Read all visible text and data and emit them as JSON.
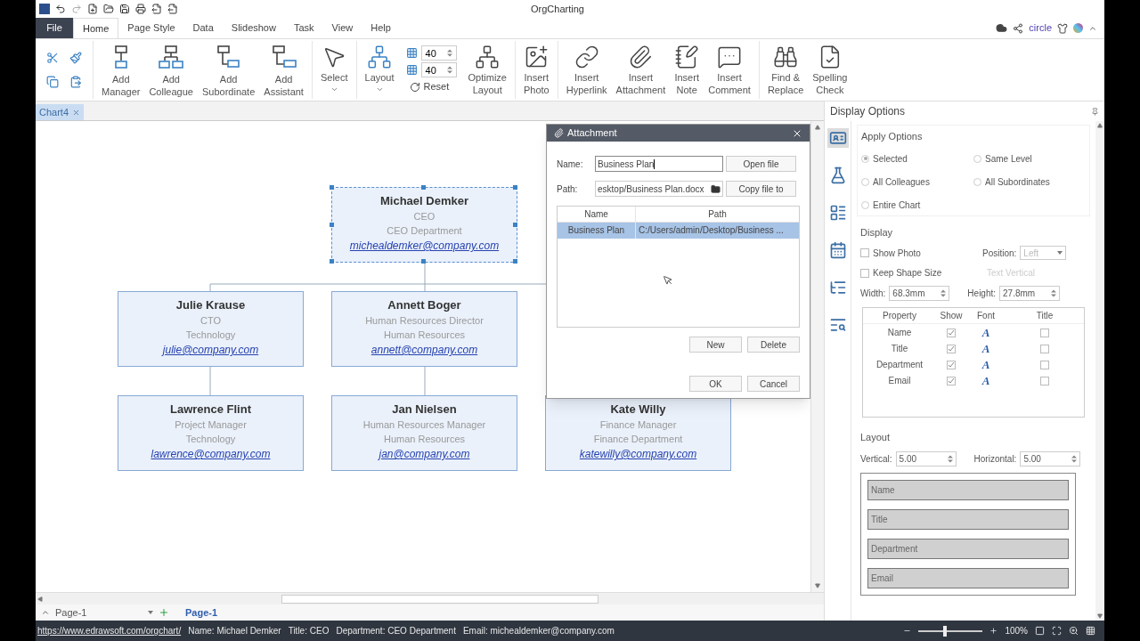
{
  "title_bar": {
    "title": "OrgCharting"
  },
  "menu": {
    "file": "File",
    "tabs": [
      {
        "label": "Home",
        "selected": true
      },
      {
        "label": "Page Style",
        "selected": false
      },
      {
        "label": "Data",
        "selected": false
      },
      {
        "label": "Slideshow",
        "selected": false
      },
      {
        "label": "Task",
        "selected": false
      },
      {
        "label": "View",
        "selected": false
      },
      {
        "label": "Help",
        "selected": false
      }
    ],
    "account": "circle"
  },
  "ribbon": {
    "buttons": [
      {
        "kind": "manager",
        "label": [
          "Add",
          "Manager"
        ]
      },
      {
        "kind": "colleague",
        "label": [
          "Add",
          "Colleague"
        ]
      },
      {
        "kind": "subordinate",
        "label": [
          "Add",
          "Subordinate"
        ]
      },
      {
        "kind": "assistant",
        "label": [
          "Add",
          "Assistant"
        ]
      },
      {
        "kind": "select",
        "label": [
          "Select"
        ],
        "dropdown": true
      },
      {
        "kind": "layout",
        "label": [
          "Layout"
        ],
        "dropdown": true
      },
      {
        "kind": "spacing",
        "values": [
          "40",
          "40"
        ],
        "reset": "Reset"
      },
      {
        "kind": "optimize",
        "label": [
          "Optimize",
          "Layout"
        ]
      },
      {
        "kind": "photo",
        "label": [
          "Insert",
          "Photo"
        ]
      },
      {
        "kind": "hyperlink",
        "label": [
          "Insert",
          "Hyperlink"
        ]
      },
      {
        "kind": "attachment",
        "label": [
          "Insert",
          "Attachment"
        ]
      },
      {
        "kind": "note",
        "label": [
          "Insert",
          "Note"
        ]
      },
      {
        "kind": "comment",
        "label": [
          "Insert",
          "Comment"
        ]
      },
      {
        "kind": "find",
        "label": [
          "Find &",
          "Replace"
        ]
      },
      {
        "kind": "spelling",
        "label": [
          "Spelling",
          "Check"
        ]
      }
    ]
  },
  "document_tabs": [
    {
      "label": "Chart4",
      "selected": true
    }
  ],
  "chart": {
    "nodes": [
      {
        "name": "Michael Demker",
        "title": "CEO",
        "department": "CEO Department",
        "email": "michealdemker@company.com",
        "selected": true
      },
      {
        "name": "Julie Krause",
        "title": "CTO",
        "department": "Technology",
        "email": "julie@company.com",
        "selected": false
      },
      {
        "name": "Annett Boger",
        "title": "Human Resources Director",
        "department": "Human Resources",
        "email": "annett@company.com",
        "selected": false
      },
      {
        "name": "Lawrence Flint",
        "title": "Project Manager",
        "department": "Technology",
        "email": "lawrence@company.com",
        "selected": false
      },
      {
        "name": "Jan Nielsen",
        "title": "Human Resources Manager",
        "department": "Human Resources",
        "email": "jan@company.com",
        "selected": false
      },
      {
        "name": "Kate Willy",
        "title": "Finance Manager",
        "department": "Finance Department",
        "email": "katewilly@company.com",
        "selected": false
      }
    ]
  },
  "dialog": {
    "title": "Attachment",
    "name_label": "Name:",
    "name_value": "Business Plan",
    "open_button": "Open file",
    "path_label": "Path:",
    "path_value": "esktop/Business Plan.docx",
    "copy_button": "Copy file to",
    "columns": [
      "Name",
      "Path"
    ],
    "rows": [
      {
        "name": "Business Plan",
        "path": "C:/Users/admin/Desktop/Business ...",
        "selected": true
      }
    ],
    "buttons": [
      "New",
      "Delete",
      "OK",
      "Cancel"
    ]
  },
  "display_options": {
    "title": "Display Options",
    "side_icons": [
      {
        "kind": "card",
        "selected": true
      },
      {
        "kind": "bottle",
        "selected": false
      },
      {
        "kind": "list",
        "selected": false
      },
      {
        "kind": "calendar",
        "selected": false
      },
      {
        "kind": "tree",
        "selected": false
      },
      {
        "kind": "search",
        "selected": false
      }
    ],
    "apply_title": "Apply Options",
    "apply_options": [
      {
        "label": "Selected",
        "selected": true
      },
      {
        "label": "Same Level",
        "selected": false
      },
      {
        "label": "All Colleagues",
        "selected": false
      },
      {
        "label": "All Subordinates",
        "selected": false
      },
      {
        "label": "Entire Chart",
        "selected": false
      }
    ],
    "display_title": "Display",
    "show_photo": {
      "label": "Show Photo",
      "checked": false
    },
    "position": {
      "label": "Position:",
      "value": "Left",
      "disabled": true
    },
    "keep_shape_size": {
      "label": "Keep Shape Size",
      "checked": false
    },
    "text_vertical": {
      "label": "Text Vertical",
      "disabled": true
    },
    "width": {
      "label": "Width:",
      "value": "68.3mm"
    },
    "height": {
      "label": "Height:",
      "value": "27.8mm"
    },
    "property_columns": [
      "Property",
      "Show",
      "Font",
      "Title"
    ],
    "properties": [
      {
        "name": "Name",
        "show": true,
        "font": "A",
        "title": false
      },
      {
        "name": "Title",
        "show": true,
        "font": "A",
        "title": false
      },
      {
        "name": "Department",
        "show": true,
        "font": "A",
        "title": false
      },
      {
        "name": "Email",
        "show": true,
        "font": "A",
        "title": false
      }
    ],
    "layout_title": "Layout",
    "vertical": {
      "label": "Vertical:",
      "value": "5.00"
    },
    "horizontal": {
      "label": "Horizontal:",
      "value": "5.00"
    },
    "preview_fields": [
      "Name",
      "Title",
      "Department",
      "Email"
    ]
  },
  "page_tabs": {
    "current": "Page-1",
    "tabs": [
      {
        "label": "Page-1",
        "selected": true
      }
    ]
  },
  "status_bar": {
    "link": "https://www.edrawsoft.com/orgchart/",
    "fields": [
      "Name: Michael Demker",
      "Title: CEO",
      "Department: CEO Department",
      "Email: michealdemker@company.com"
    ],
    "zoom": {
      "level": 0.4,
      "reading": "100%"
    }
  }
}
